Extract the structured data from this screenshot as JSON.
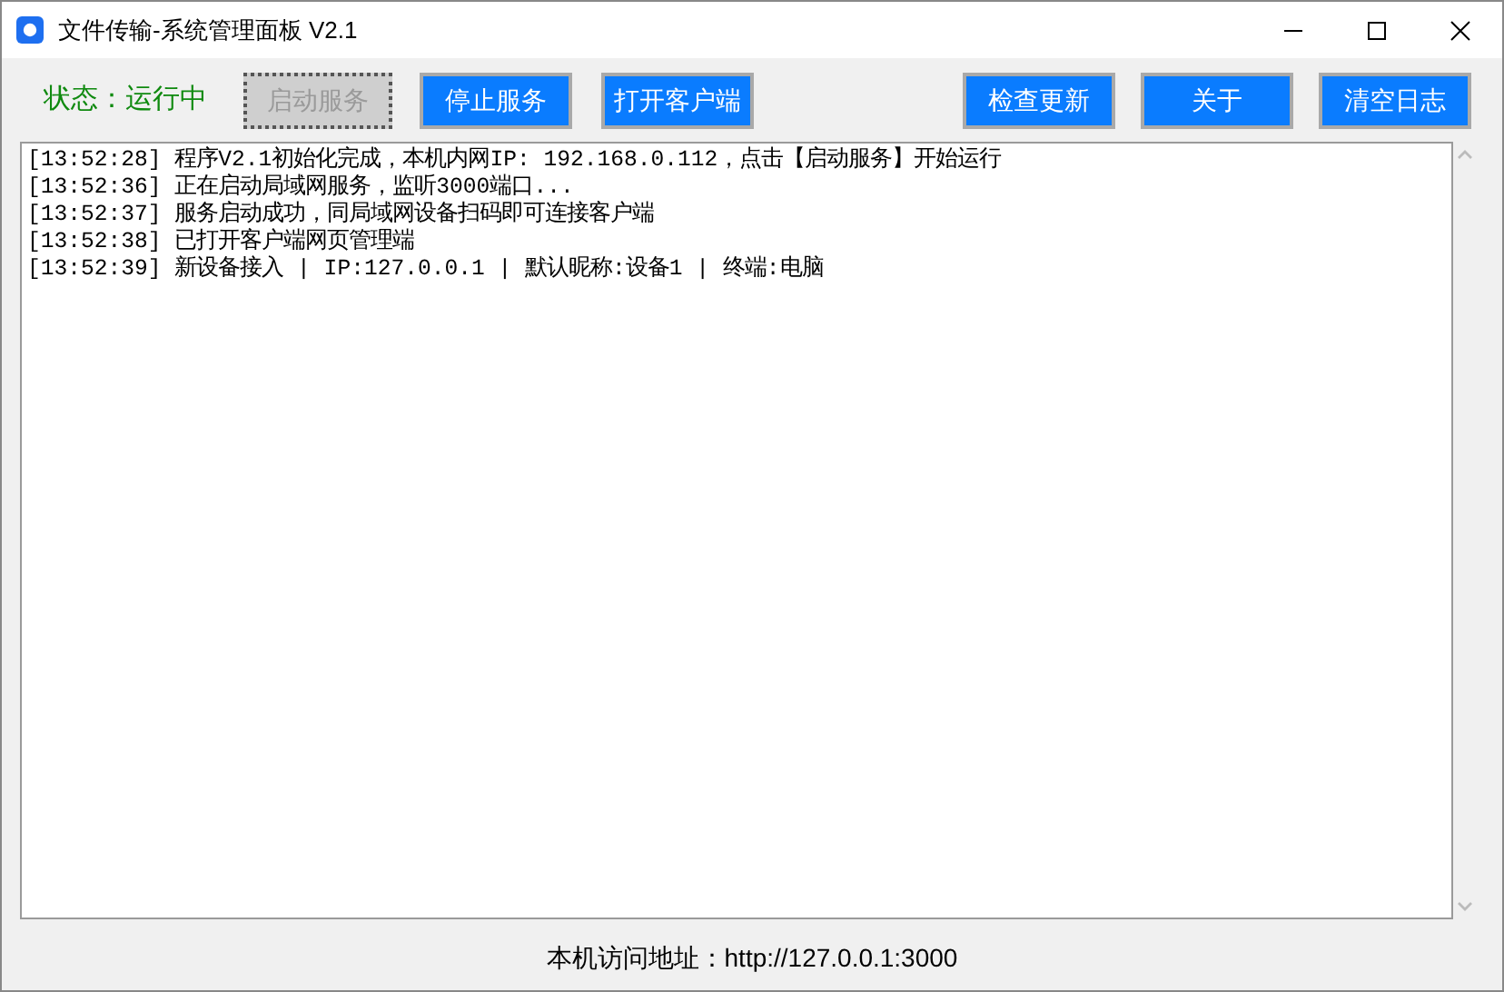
{
  "window": {
    "title": "文件传输-系统管理面板 V2.1"
  },
  "status": {
    "text": "状态：运行中"
  },
  "left_buttons": [
    {
      "label": "启动服务",
      "disabled": true
    },
    {
      "label": "停止服务",
      "disabled": false
    },
    {
      "label": "打开客户端",
      "disabled": false
    }
  ],
  "right_buttons": [
    {
      "label": "检查更新",
      "disabled": false
    },
    {
      "label": "关于",
      "disabled": false
    },
    {
      "label": "清空日志",
      "disabled": false
    }
  ],
  "log": [
    {
      "time": "[13:52:28]",
      "message": "程序V2.1初始化完成，本机内网IP: 192.168.0.112，点击【启动服务】开始运行"
    },
    {
      "time": "[13:52:36]",
      "message": "正在启动局域网服务，监听3000端口..."
    },
    {
      "time": "[13:52:37]",
      "message": "服务启动成功，同局域网设备扫码即可连接客户端"
    },
    {
      "time": "[13:52:38]",
      "message": "已打开客户端网页管理端"
    },
    {
      "time": "[13:52:39]",
      "message": "新设备接入 | IP:127.0.0.1 | 默认昵称:设备1 | 终端:电脑"
    }
  ],
  "footer": {
    "text": "本机访问地址：http://127.0.0.1:3000"
  }
}
